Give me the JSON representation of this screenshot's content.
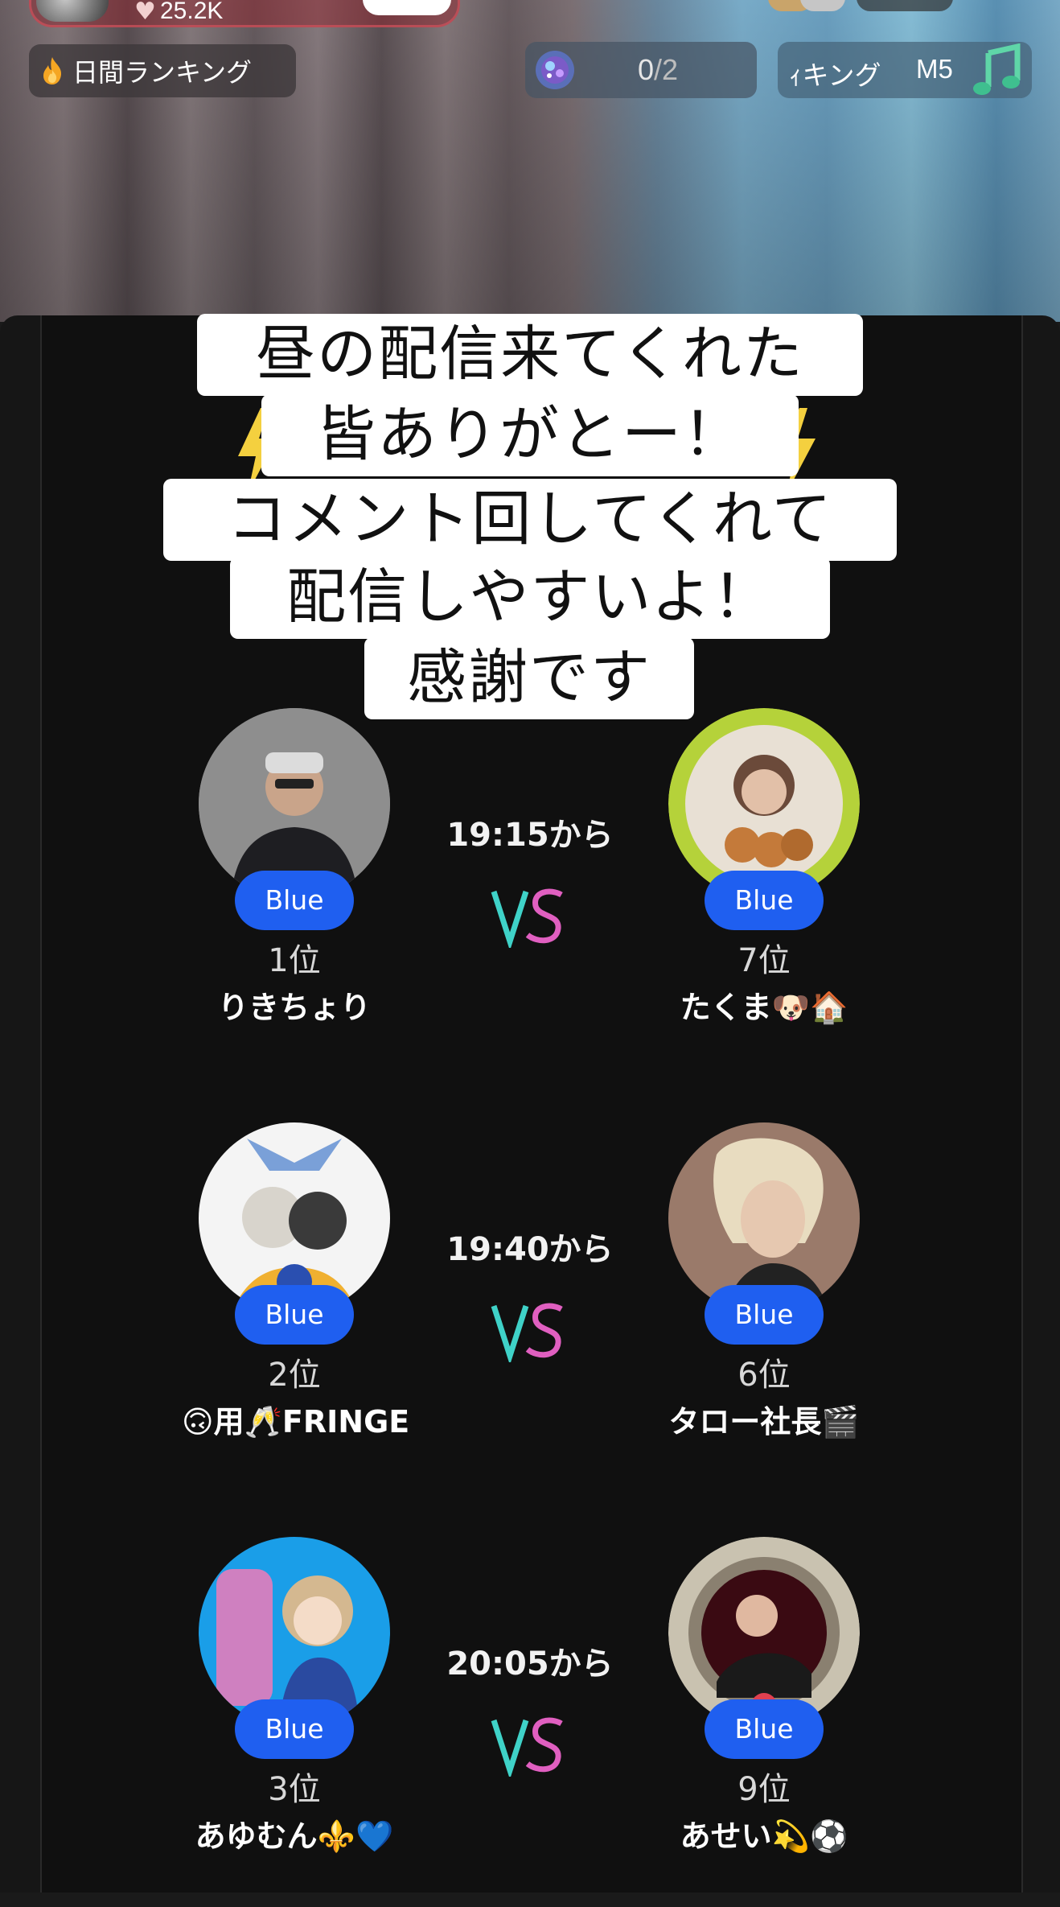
{
  "stream": {
    "likes": "25.2K",
    "daily_ranking_label": "日間ランキング",
    "progress_current": "0",
    "progress_total": "/2",
    "ranking_partial": "ｨキング",
    "ranking_level": "M5"
  },
  "caption": {
    "lines": [
      "昼の配信来てくれた",
      "皆ありがとー！",
      "コメント回してくれて",
      "配信しやすいよ！",
      "感謝です"
    ]
  },
  "matches": [
    {
      "time": "19:15から",
      "left": {
        "badge": "Blue",
        "rank": "1位",
        "name": "りきちょり"
      },
      "right": {
        "badge": "Blue",
        "rank": "7位",
        "name": "たくま🐶🏠"
      }
    },
    {
      "time": "19:40から",
      "left": {
        "badge": "Blue",
        "rank": "2位",
        "name": "🙃用🥂FRINGE"
      },
      "right": {
        "badge": "Blue",
        "rank": "6位",
        "name": "タロー社長🎬"
      }
    },
    {
      "time": "20:05から",
      "left": {
        "badge": "Blue",
        "rank": "3位",
        "name": "あゆむん⚜️💙"
      },
      "right": {
        "badge": "Blue",
        "rank": "9位",
        "name": "あせい💫⚽"
      }
    }
  ],
  "colors": {
    "badge_blue": "#1f5ff0",
    "panel_bg": "#101010",
    "caption_bg": "#ffffff"
  },
  "icons": [
    "flame-icon",
    "gem-icon",
    "music-note-icon",
    "vs-icon",
    "lightning-icon",
    "heart-icon"
  ]
}
